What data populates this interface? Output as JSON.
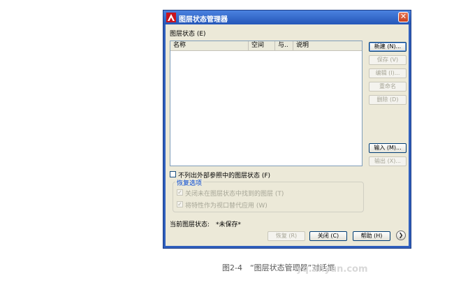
{
  "dialog": {
    "title": "图层状态管理器",
    "close_glyph": "✕",
    "layer_states_label": "图层状态 (E)",
    "columns": [
      "名称",
      "空间",
      "与..",
      "说明"
    ],
    "buttons": {
      "new": "新建 (N)...",
      "save": "保存 (V)",
      "edit": "编辑 (I)...",
      "rename": "重命名",
      "delete": "删除 (D)",
      "import": "输入 (M)...",
      "export": "输出 (X)..."
    },
    "exclude_xref_checkbox": "不列出外部参照中的图层状态 (F)",
    "restore_group": {
      "title": "恢复选项",
      "option1": "关闭未在图层状态中找到的图层 (T)",
      "option2": "将特性作为视口替代应用 (W)"
    },
    "current_state_label": "当前图层状态:",
    "current_state_value": "*未保存*",
    "bottom": {
      "restore": "恢复 (R)",
      "close": "关闭 (C)",
      "help": "帮助 (H)",
      "expand_glyph": "❯"
    }
  },
  "caption": "图2-4　“图层状态管理器”对话框",
  "watermark": "yq.aliyun.com"
}
